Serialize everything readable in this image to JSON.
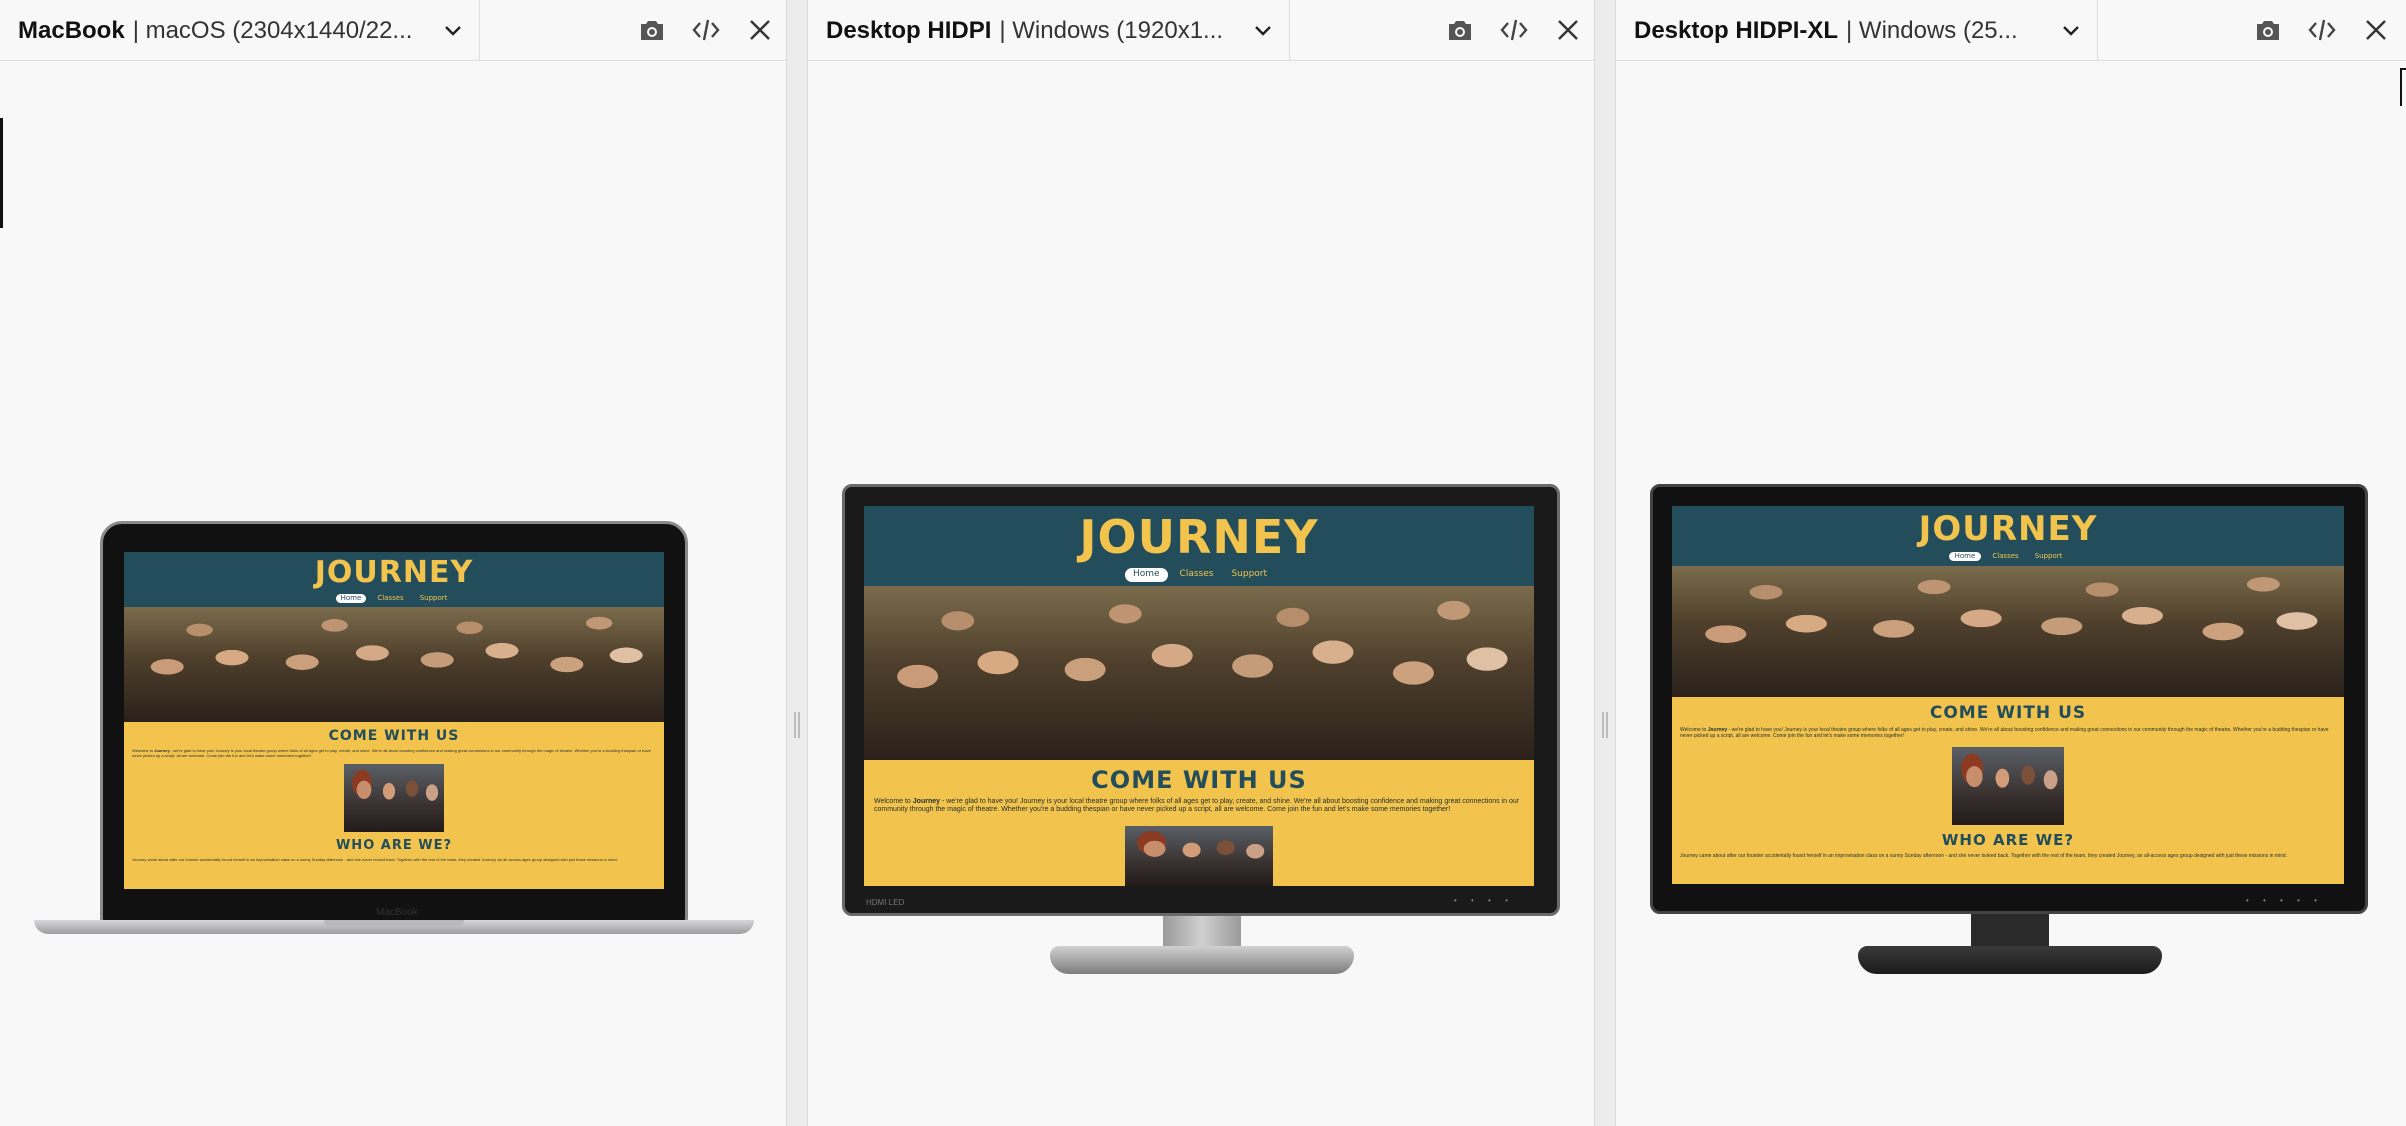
{
  "panels": [
    {
      "device_name": "MacBook",
      "device_spec": "| macOS (2304x1440/22...",
      "icons": [
        "camera-icon",
        "code-icon",
        "close-icon"
      ]
    },
    {
      "device_name": "Desktop HIDPI",
      "device_spec": "| Windows (1920x1...",
      "icons": [
        "camera-icon",
        "code-icon",
        "close-icon"
      ]
    },
    {
      "device_name": "Desktop HIDPI-XL",
      "device_spec": "| Windows (25...",
      "icons": [
        "camera-icon",
        "code-icon",
        "close-icon"
      ]
    }
  ],
  "site": {
    "logo": "JOURNEY",
    "nav": [
      "Home",
      "Classes",
      "Support"
    ],
    "section1_title": "COME WITH US",
    "section1_intro_prefix": "Welcome to ",
    "section1_brand": "Journey",
    "section1_text": " - we're glad to have you! Journey is your local theatre group where folks of all ages get to play, create, and shine. We're all about boosting confidence and making great connections in our community through the magic of theatre. Whether you're a budding thespian or have never picked up a script, all are welcome. Come join the fun and let's make some memories together!",
    "section2_title": "WHO ARE WE?",
    "section2_text": "Journey came about after our founder accidentally found herself in an improvisation class on a sunny Sunday afternoon - and she never looked back. Together with the rest of the team, they created Journey, an all-access ages group designed with just these missions in mind."
  },
  "devices": {
    "macbook_label": "MacBook",
    "monitor_brand": "HDMI LED"
  },
  "colors": {
    "site_header": "#234d5b",
    "site_accent": "#f2c44e"
  }
}
